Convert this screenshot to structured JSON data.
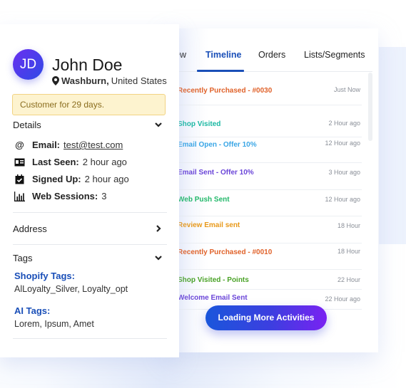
{
  "customer": {
    "initials": "JD",
    "name": "John Doe",
    "city": "Washburn,",
    "country": "United States",
    "since_banner": "Customer for 29 days."
  },
  "details": {
    "title": "Details",
    "email_label": "Email:",
    "email_value": "test@test.com",
    "last_seen_label": "Last Seen:",
    "last_seen_value": "2 hour ago",
    "signed_up_label": "Signed Up:",
    "signed_up_value": "2 hour ago",
    "web_sessions_label": "Web Sessions:",
    "web_sessions_value": "3"
  },
  "address": {
    "title": "Address"
  },
  "tags": {
    "title": "Tags",
    "shopify_title": "Shopify Tags:",
    "shopify_values": "AlLoyalty_Silver, Loyalty_opt",
    "ai_title": "AI Tags:",
    "ai_values": "Lorem, Ipsum, Amet"
  },
  "tabs": [
    {
      "label": "ew",
      "active": false
    },
    {
      "label": "Timeline",
      "active": true
    },
    {
      "label": "Orders",
      "active": false
    },
    {
      "label": "Lists/Segments",
      "active": false
    }
  ],
  "timeline": [
    {
      "label": "Recently Purchased - #0030",
      "time": "Just Now",
      "color": "#e0622a"
    },
    {
      "label": "Shop Visited",
      "time": "2 Hour ago",
      "color": "#1bb8a3"
    },
    {
      "label": "Email Open - Offer 10%",
      "time": "12 Hour ago",
      "color": "#3aa6e6"
    },
    {
      "label": "Email Sent - Offer 10%",
      "time": "3 Hour ago",
      "color": "#6a45d8"
    },
    {
      "label": "Web Push Sent",
      "time": "12 Hour ago",
      "color": "#22b86a"
    },
    {
      "label": "Review Email sent",
      "time": "18 Hour",
      "color": "#e8991a"
    },
    {
      "label": "Recently Purchased - #0010",
      "time": "18 Hour",
      "color": "#e0622a"
    },
    {
      "label": "Shop Visited - Points",
      "time": "22 Hour",
      "color": "#4aa227"
    },
    {
      "label": "Welcome Email Sent",
      "time": "22 Hour ago",
      "color": "#6a45d8"
    }
  ],
  "load_more_label": "Loading More Activities",
  "colors": {
    "accent": "#1a4fb8",
    "banner_bg": "#fdf3cf",
    "banner_border": "#f2d383"
  }
}
